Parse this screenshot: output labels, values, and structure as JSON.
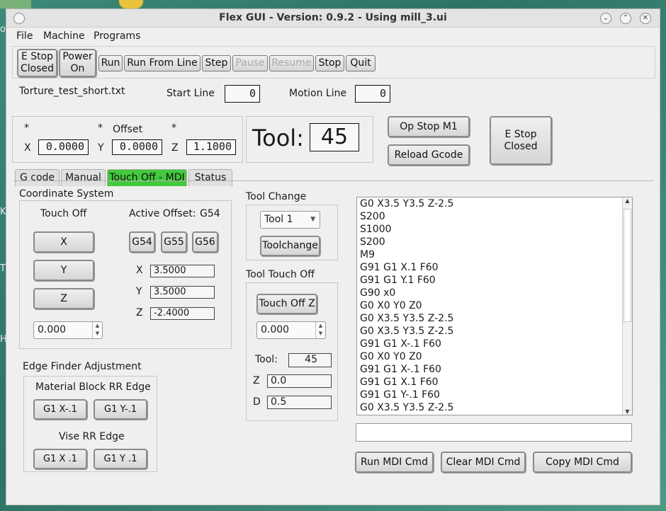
{
  "desktop": {
    "side_labels": [
      "on",
      "KY",
      "T",
      "HA"
    ]
  },
  "window": {
    "title": "Flex GUI - Version: 0.9.2 - Using mill_3.ui",
    "controls": [
      "⌄",
      "⌃",
      "✕"
    ]
  },
  "menu": [
    "File",
    "Machine",
    "Programs"
  ],
  "toolbar": {
    "estop": "E Stop\nClosed",
    "power": "Power\nOn",
    "run": "Run",
    "run_from_line": "Run From Line",
    "step": "Step",
    "pause": "Pause",
    "resume": "Resume",
    "stop": "Stop",
    "quit": "Quit"
  },
  "status": {
    "file_name": "Torture_test_short.txt",
    "start_line_label": "Start Line",
    "start_line_value": "0",
    "motion_line_label": "Motion Line",
    "motion_line_value": "0"
  },
  "dro": {
    "x_star": "*",
    "y_star": "*",
    "z_star": "*",
    "offset_label": "Offset",
    "x_label": "X",
    "x_value": "0.0000",
    "y_label": "Y",
    "y_value": "0.0000",
    "z_label": "Z",
    "z_value": "1.1000"
  },
  "tool": {
    "label": "Tool:",
    "number": "45"
  },
  "side_buttons": {
    "op_stop": "Op Stop M1",
    "reload": "Reload Gcode",
    "estop": "E Stop\nClosed"
  },
  "tabs": [
    {
      "label": "G code",
      "active": false
    },
    {
      "label": "Manual",
      "active": false
    },
    {
      "label": "Touch Off - MDI",
      "active": true
    },
    {
      "label": "Status",
      "active": false
    }
  ],
  "coord_system": {
    "title": "Coordinate System",
    "touch_off_label": "Touch Off",
    "active_offset_label": "Active Offset:",
    "active_offset_value": "G54",
    "btn_x": "X",
    "btn_y": "Y",
    "btn_z": "Z",
    "g54": "G54",
    "g55": "G55",
    "g56": "G56",
    "x_label": "X",
    "x_value": "3.5000",
    "y_label": "Y",
    "y_value": "3.5000",
    "z_label": "Z",
    "z_value": "-2.4000",
    "spin_value": "0.000"
  },
  "edge_finder": {
    "title": "Edge Finder Adjustment",
    "material_label": "Material Block RR Edge",
    "btn_xm": "G1 X-.1",
    "btn_ym": "G1 Y-.1",
    "vise_label": "Vise RR Edge",
    "btn_xp": "G1 X .1",
    "btn_yp": "G1 Y .1"
  },
  "tool_change": {
    "title": "Tool Change",
    "select_value": "Tool 1",
    "button": "Toolchange"
  },
  "tool_touch_off": {
    "title": "Tool Touch Off",
    "button": "Touch Off Z",
    "spin_value": "0.000",
    "tool_label": "Tool:",
    "tool_value": "45",
    "z_label": "Z",
    "z_value": "0.0",
    "d_label": "D",
    "d_value": "0.5"
  },
  "mdi": {
    "history": [
      "G0 X3.5 Y3.5 Z-2.5",
      "S200",
      "S1000",
      "S200",
      "M9",
      "G91 G1 X.1 F60",
      "G91 G1 Y.1 F60",
      "G90 x0",
      "G0 X0 Y0 Z0",
      "G0 X3.5 Y3.5 Z-2.5",
      "G0 X3.5 Y3.5 Z-2.5",
      "G91 G1 X-.1 F60",
      "G0 X0 Y0 Z0",
      "G91 G1 X-.1 F60",
      "G91 G1 X.1 F60",
      "G91 G1 Y-.1 F60",
      "G0 X3.5 Y3.5 Z-2.5"
    ],
    "input_value": "",
    "run_btn": "Run MDI Cmd",
    "clear_btn": "Clear MDI Cmd",
    "copy_btn": "Copy MDI Cmd"
  },
  "colors": {
    "active_tab": "#43c93c",
    "desktop": "#3d8a78"
  }
}
